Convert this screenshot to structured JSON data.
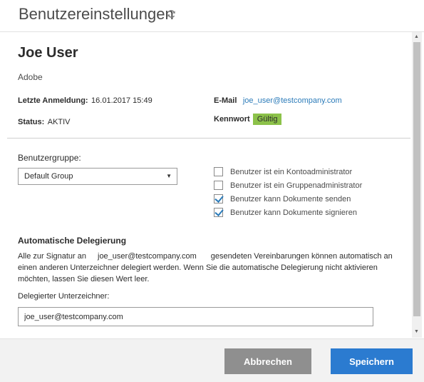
{
  "header": {
    "title": "Benutzereinstellungen",
    "refresh_icon": "refresh-icon"
  },
  "user": {
    "name": "Joe User",
    "company": "Adobe",
    "last_login_label": "Letzte Anmeldung:",
    "last_login_value": "16.01.2017 15:49",
    "status_label": "Status:",
    "status_value": "AKTIV",
    "email_label": "E-Mail",
    "email_value": "joe_user@testcompany.com",
    "password_label": "Kennwort",
    "password_status": "Gültig"
  },
  "group": {
    "label": "Benutzergruppe:",
    "selected": "Default Group"
  },
  "checkboxes": [
    {
      "label": "Benutzer ist ein Kontoadministrator",
      "checked": false
    },
    {
      "label": "Benutzer ist ein Gruppenadministrator",
      "checked": false
    },
    {
      "label": "Benutzer kann Dokumente senden",
      "checked": true
    },
    {
      "label": "Benutzer kann Dokumente signieren",
      "checked": true
    }
  ],
  "delegation": {
    "title": "Automatische Delegierung",
    "text_start": "Alle zur Signatur an",
    "text_email": "joe_user@testcompany.com",
    "text_end": "gesendeten Vereinbarungen können automatisch an einen anderen Unterzeichner delegiert werden. Wenn Sie die automatische Delegierung nicht aktivieren möchten, lassen Sie diesen Wert leer.",
    "delegate_label": "Delegierter Unterzeichner:",
    "delegate_value": "joe_user@testcompany.com"
  },
  "footer": {
    "cancel_label": "Abbrechen",
    "save_label": "Speichern"
  },
  "colors": {
    "accent": "#2b7bd0",
    "badge": "#8cc24a",
    "cancel": "#8f8f8f"
  }
}
